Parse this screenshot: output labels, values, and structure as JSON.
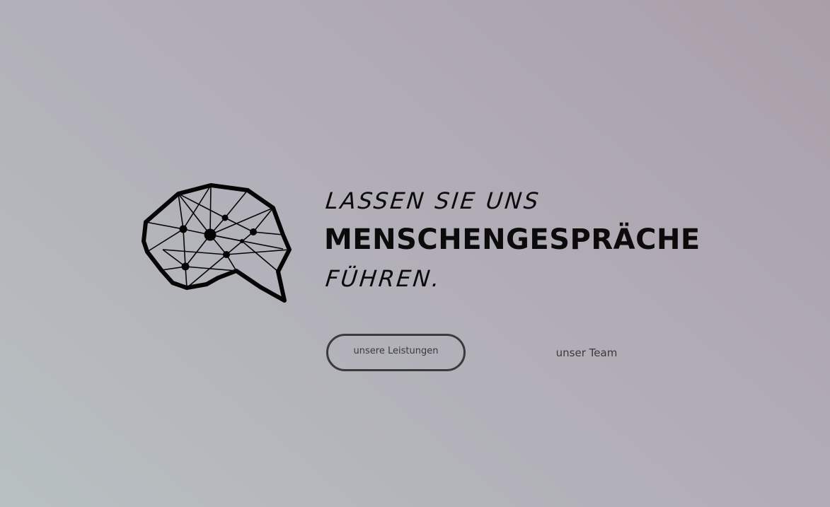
{
  "hero": {
    "headline_top": "LASSEN SIE UNS",
    "headline_main": "MENSCHENGESPRÄCHE",
    "headline_bottom": "FÜHREN.",
    "logo_icon": "brain-network-speech-bubble-icon"
  },
  "actions": {
    "primary_label": "unsere Leistungen",
    "secondary_label": "unser Team"
  },
  "colors": {
    "text": "#0b0b0b",
    "button_border": "#3b3b3b"
  }
}
